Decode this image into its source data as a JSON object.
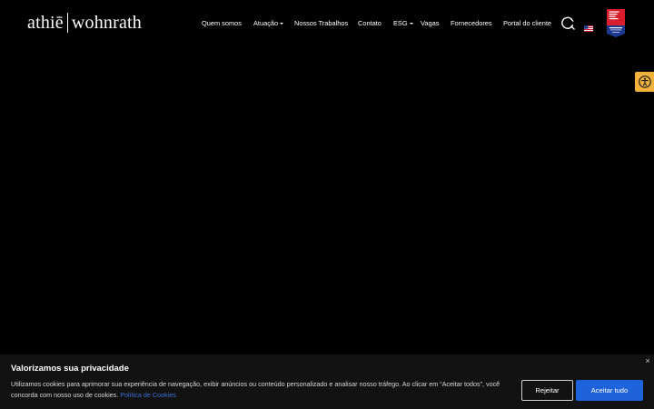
{
  "brand": {
    "name_left": "athiē",
    "name_right": "wohnrath"
  },
  "nav": {
    "items": [
      {
        "label": "Quem somos"
      },
      {
        "label": "Atuação"
      },
      {
        "label": "Nossos Trabalhos"
      },
      {
        "label": "Contato"
      },
      {
        "label": "ESG"
      },
      {
        "label": "Vagas"
      },
      {
        "label": "Fornecedores"
      },
      {
        "label": "Portal do cliente"
      }
    ]
  },
  "icons": {
    "search": "search-icon",
    "language": "us-flag-icon",
    "certification": "great-place-to-work-badge",
    "accessibility": "accessibility-icon"
  },
  "cookie_banner": {
    "title": "Valorizamos sua privacidade",
    "text": "Utilizamos cookies para aprimorar sua experiência de navegação, exibir anúncios ou conteúdo personalizado e analisar nosso tráfego. Ao clicar em “Aceitar todos”, você concorda com nosso uso de cookies.",
    "policy_link": "Política de Cookies",
    "reject_label": "Rejeitar",
    "accept_label": "Aceitar tudo",
    "close_label": "×"
  },
  "colors": {
    "background": "#000000",
    "accept_button": "#1e63dc",
    "link": "#3a6fd8",
    "accessibility_button": "#f0b23b",
    "badge_red": "#d81e2c",
    "badge_blue": "#1b3a8f"
  }
}
